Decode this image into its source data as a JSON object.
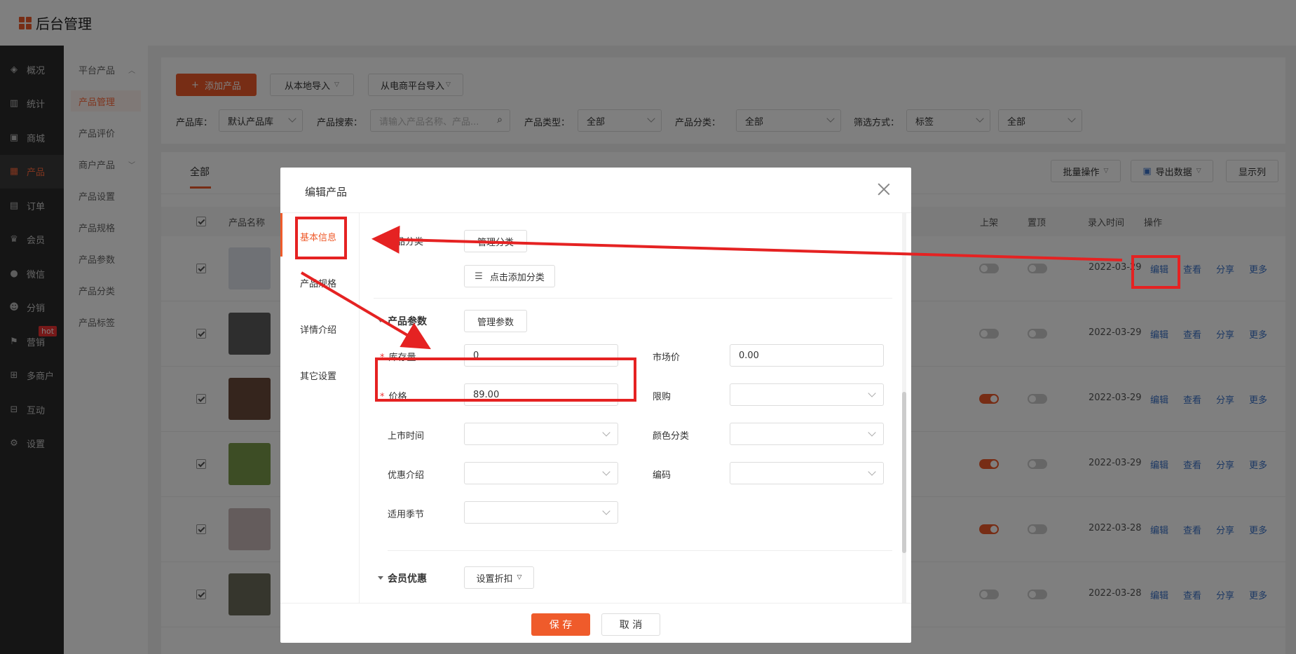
{
  "app": {
    "title": "后台管理"
  },
  "sidebar": {
    "items": [
      {
        "label": "概况",
        "icon": "layers-icon"
      },
      {
        "label": "统计",
        "icon": "chart-icon"
      },
      {
        "label": "商城",
        "icon": "store-icon"
      },
      {
        "label": "产品",
        "icon": "grid-icon"
      },
      {
        "label": "订单",
        "icon": "order-icon"
      },
      {
        "label": "会员",
        "icon": "crown-icon"
      },
      {
        "label": "微信",
        "icon": "wechat-icon"
      },
      {
        "label": "分销",
        "icon": "users-icon"
      },
      {
        "label": "营销",
        "icon": "flag-icon",
        "badge": "hot"
      },
      {
        "label": "多商户",
        "icon": "shop-icon"
      },
      {
        "label": "互动",
        "icon": "interact-icon"
      },
      {
        "label": "设置",
        "icon": "gear-icon"
      }
    ]
  },
  "subnav": {
    "items": [
      "平台产品",
      "产品管理",
      "产品评价",
      "商户产品",
      "产品设置",
      "产品规格",
      "产品参数",
      "产品分类",
      "产品标签"
    ]
  },
  "toolbar": {
    "add_label": "添加产品",
    "import_local": "从本地导入",
    "import_platform": "从电商平台导入"
  },
  "filters": {
    "library_label": "产品库：",
    "library_value": "默认产品库",
    "search_label": "产品搜索：",
    "search_placeholder": "请输入产品名称、产品...",
    "type_label": "产品类型：",
    "type_value": "全部",
    "category_label": "产品分类：",
    "category_value": "全部",
    "filter_label": "筛选方式：",
    "filter_value": "标签",
    "filter_value2": "全部"
  },
  "tabs": {
    "all": "全部"
  },
  "actions": {
    "batch": "批量操作",
    "export": "导出数据",
    "columns": "显示列"
  },
  "table": {
    "headers": {
      "name": "产品名称",
      "on_shelf": "上架",
      "pin": "置顶",
      "time": "录入时间",
      "ops": "操作"
    },
    "rows": [
      {
        "date": "2022-03-29",
        "on_shelf": false,
        "pin": false,
        "thumb_color": "#dfe3ea"
      },
      {
        "date": "2022-03-29",
        "on_shelf": false,
        "pin": false,
        "thumb_color": "#5d5d5d"
      },
      {
        "date": "2022-03-29",
        "on_shelf": true,
        "pin": false,
        "thumb_color": "#6b4a3a"
      },
      {
        "date": "2022-03-29",
        "on_shelf": true,
        "pin": false,
        "thumb_color": "#7a9a4a"
      },
      {
        "date": "2022-03-28",
        "on_shelf": true,
        "pin": false,
        "thumb_color": "#c9b8b8"
      },
      {
        "date": "2022-03-28",
        "on_shelf": false,
        "pin": false,
        "thumb_color": "#6d6d5a"
      }
    ],
    "op_labels": {
      "edit": "编辑",
      "view": "查看",
      "share": "分享",
      "more": "更多"
    }
  },
  "modal": {
    "title": "编辑产品",
    "nav": [
      "基本信息",
      "产品规格",
      "详情介绍",
      "其它设置"
    ],
    "category_label": "品分类",
    "manage_category": "管理分类",
    "add_category": "点击添加分类",
    "params_title": "产品参数",
    "manage_params": "管理参数",
    "fields": {
      "stock_label": "库存量",
      "stock_value": "0",
      "market_label": "市场价",
      "market_value": "0.00",
      "price_label": "价格",
      "price_value": "89.00",
      "limit_label": "限购",
      "launch_label": "上市时间",
      "color_label": "颜色分类",
      "promo_label": "优惠介绍",
      "code_label": "编码",
      "season_label": "适用季节"
    },
    "member_title": "会员优惠",
    "discount_btn": "设置折扣",
    "save": "保 存",
    "cancel": "取 消"
  },
  "colors": {
    "accent": "#ef5b2b",
    "annotation": "#e52222",
    "link": "#3a72c9"
  }
}
